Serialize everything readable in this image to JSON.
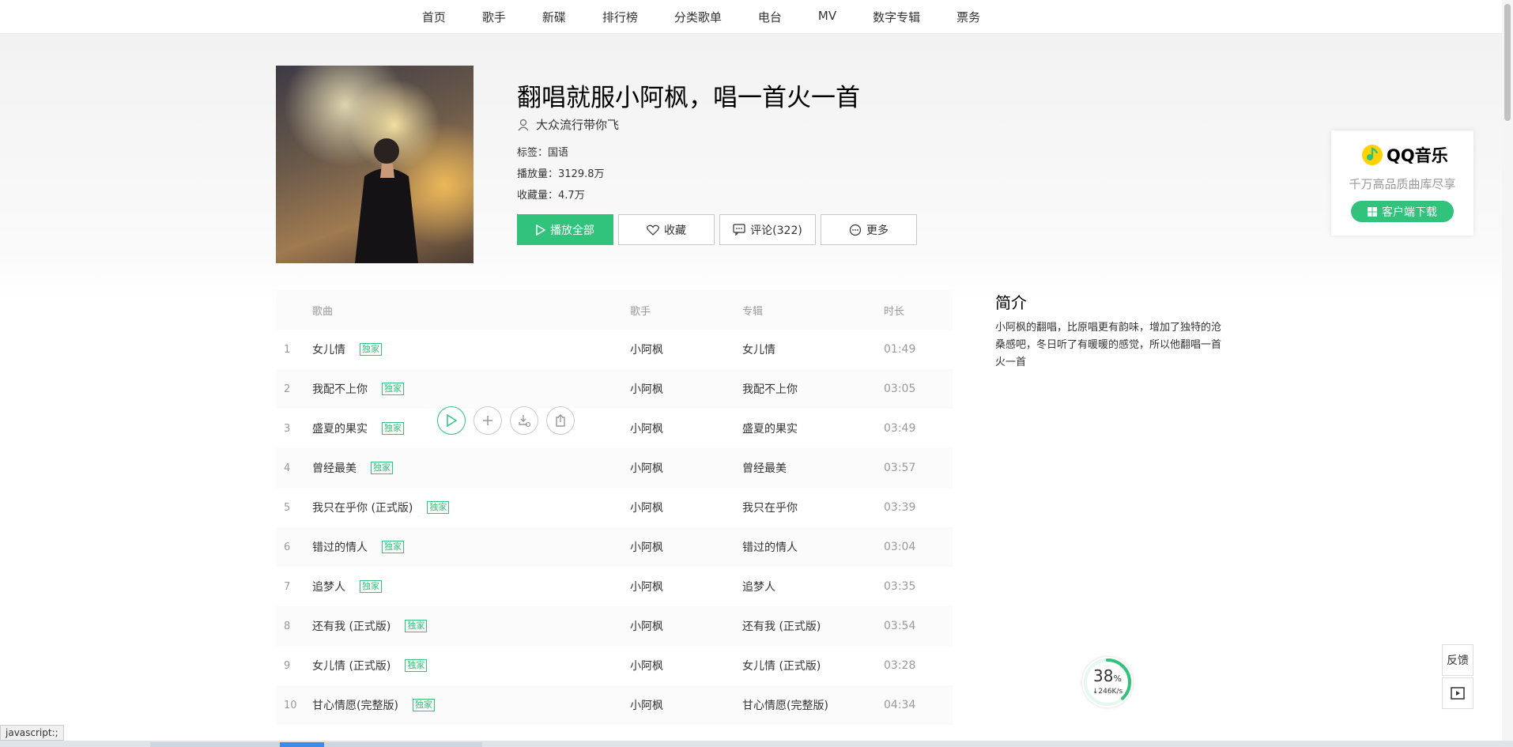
{
  "nav": {
    "items": [
      "首页",
      "歌手",
      "新碟",
      "排行榜",
      "分类歌单",
      "电台",
      "MV",
      "数字专辑",
      "票务"
    ]
  },
  "playlist": {
    "title": "翻唱就服小阿枫，唱一首火一首",
    "creator": "大众流行带你飞",
    "tag_label": "标签：",
    "tag_value": "国语",
    "plays_label": "播放量：",
    "plays_value": "3129.8万",
    "fav_label": "收藏量：",
    "fav_value": "4.7万"
  },
  "actions": {
    "play_all": "播放全部",
    "favorite": "收藏",
    "comments": "评论(322)",
    "more": "更多"
  },
  "table": {
    "headers": {
      "song": "歌曲",
      "singer": "歌手",
      "album": "专辑",
      "duration": "时长"
    },
    "badge": "独家",
    "rows": [
      {
        "num": "1",
        "song": "女儿情",
        "singer": "小阿枫",
        "album": "女儿情",
        "duration": "01:49"
      },
      {
        "num": "2",
        "song": "我配不上你",
        "singer": "小阿枫",
        "album": "我配不上你",
        "duration": "03:05"
      },
      {
        "num": "3",
        "song": "盛夏的果实",
        "singer": "小阿枫",
        "album": "盛夏的果实",
        "duration": "03:49"
      },
      {
        "num": "4",
        "song": "曾经最美",
        "singer": "小阿枫",
        "album": "曾经最美",
        "duration": "03:57"
      },
      {
        "num": "5",
        "song": "我只在乎你 (正式版)",
        "singer": "小阿枫",
        "album": "我只在乎你",
        "duration": "03:39"
      },
      {
        "num": "6",
        "song": "错过的情人",
        "singer": "小阿枫",
        "album": "错过的情人",
        "duration": "03:04"
      },
      {
        "num": "7",
        "song": "追梦人",
        "singer": "小阿枫",
        "album": "追梦人",
        "duration": "03:35"
      },
      {
        "num": "8",
        "song": "还有我 (正式版)",
        "singer": "小阿枫",
        "album": "还有我 (正式版)",
        "duration": "03:54"
      },
      {
        "num": "9",
        "song": "女儿情 (正式版)",
        "singer": "小阿枫",
        "album": "女儿情 (正式版)",
        "duration": "03:28"
      },
      {
        "num": "10",
        "song": "甘心情愿(完整版)",
        "singer": "小阿枫",
        "album": "甘心情愿(完整版)",
        "duration": "04:34"
      }
    ]
  },
  "intro": {
    "title": "简介",
    "text": "小阿枫的翻唱，比原唱更有韵味，增加了独特的沧桑感吧，冬日听了有暖暖的感觉，所以他翻唱一首火一首"
  },
  "qq_card": {
    "logo_text": "QQ音乐",
    "slogan": "千万高品质曲库尽享",
    "download": "客户端下载"
  },
  "speed_widget": {
    "percent": "38",
    "percent_sign": "%",
    "rate": "↓246K/s",
    "progress": 0.38
  },
  "side": {
    "feedback": "反馈"
  },
  "status_bar": {
    "url": "javascript:;"
  },
  "colors": {
    "accent": "#31c27c"
  }
}
